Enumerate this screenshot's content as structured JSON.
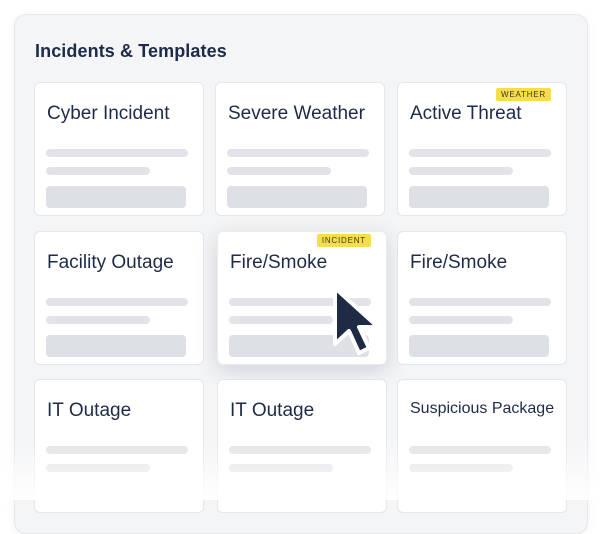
{
  "panel": {
    "title": "Incidents & Templates"
  },
  "cards": [
    {
      "title": "Cyber Incident",
      "badge": ""
    },
    {
      "title": "Severe Weather",
      "badge": ""
    },
    {
      "title": "Active Threat",
      "badge": "WEATHER"
    },
    {
      "title": "Facility Outage",
      "badge": ""
    },
    {
      "title": "Fire/Smoke",
      "badge": "INCIDENT"
    },
    {
      "title": "Fire/Smoke",
      "badge": ""
    },
    {
      "title": "IT Outage",
      "badge": ""
    },
    {
      "title": "IT Outage",
      "badge": ""
    },
    {
      "title": "Suspicious Package",
      "badge": ""
    }
  ],
  "icons": {
    "cursor": "mouse-pointer-icon"
  },
  "colors": {
    "badge": "#f7dd4c",
    "title_text": "#1d2b4a",
    "cursor": "#1f2a44"
  }
}
